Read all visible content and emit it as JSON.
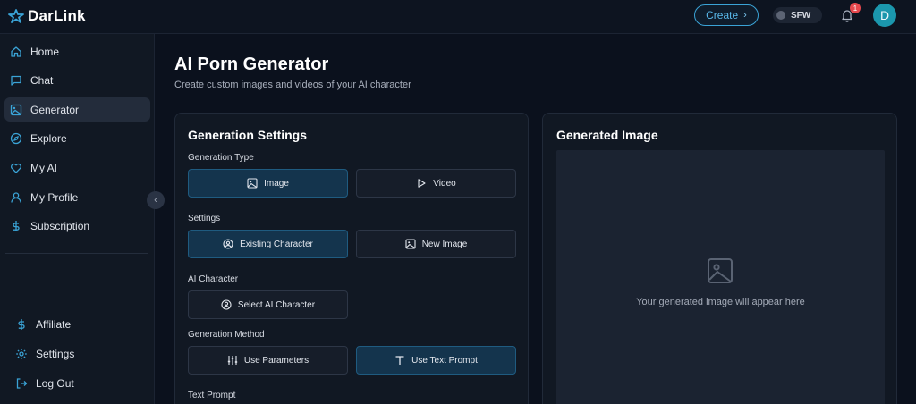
{
  "app": {
    "brand": "DarLink",
    "accent_color": "#3aa3d6"
  },
  "header": {
    "create_label": "Create",
    "sfw_label": "SFW",
    "notification_count": "1",
    "avatar_initial": "D"
  },
  "sidebar": {
    "items": [
      {
        "label": "Home",
        "icon": "home-icon",
        "active": false
      },
      {
        "label": "Chat",
        "icon": "chat-icon",
        "active": false
      },
      {
        "label": "Generator",
        "icon": "image-icon",
        "active": true
      },
      {
        "label": "Explore",
        "icon": "compass-icon",
        "active": false
      },
      {
        "label": "My AI",
        "icon": "heart-icon",
        "active": false
      },
      {
        "label": "My Profile",
        "icon": "user-icon",
        "active": false
      },
      {
        "label": "Subscription",
        "icon": "dollar-icon",
        "active": false
      }
    ],
    "bottom_items": [
      {
        "label": "Affiliate",
        "icon": "dollar-icon"
      },
      {
        "label": "Settings",
        "icon": "gear-icon"
      },
      {
        "label": "Log Out",
        "icon": "logout-icon"
      }
    ]
  },
  "main": {
    "title": "AI Porn Generator",
    "subtitle": "Create custom images and videos of your AI character",
    "settings_card": {
      "title": "Generation Settings",
      "generation_type": {
        "label": "Generation Type",
        "options": [
          "Image",
          "Video"
        ],
        "selected": "Image"
      },
      "settings": {
        "label": "Settings",
        "options": [
          "Existing Character",
          "New Image"
        ],
        "selected": "Existing Character"
      },
      "ai_character": {
        "label": "AI Character",
        "button": "Select AI Character"
      },
      "generation_method": {
        "label": "Generation Method",
        "options": [
          "Use Parameters",
          "Use Text Prompt"
        ],
        "selected": "Use Text Prompt"
      },
      "text_prompt": {
        "label": "Text Prompt"
      }
    },
    "result_card": {
      "title": "Generated Image",
      "empty_text": "Your generated image will appear here"
    }
  }
}
